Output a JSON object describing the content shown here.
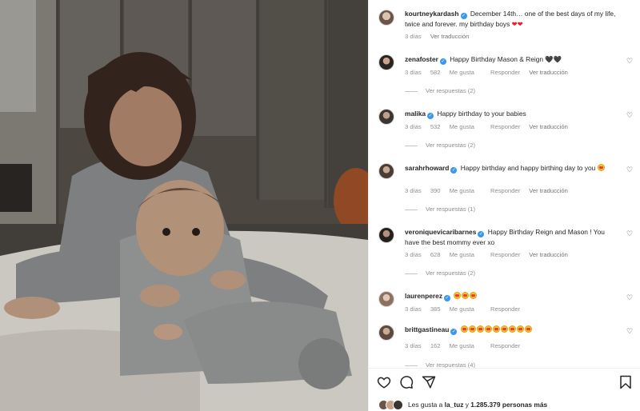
{
  "post": {
    "author": "kourtneykardash",
    "caption": "December 14th… one of the best days of my life, twice and forever. my birthday boys",
    "caption_emoji": "❤❤",
    "age": "3 días",
    "translate": "Ver traducción"
  },
  "labels": {
    "likes_suffix": "Me gusta",
    "reply": "Responder",
    "translate": "Ver traducción"
  },
  "comments": [
    {
      "user": "zenafoster",
      "text": "Happy Birthday Mason & Reign",
      "emoji": "🖤🖤",
      "age": "3 días",
      "likes": "582",
      "replies": "Ver respuestas (2)"
    },
    {
      "user": "malika",
      "text": "Happy birthday to your babies",
      "age": "3 días",
      "likes": "532",
      "replies": "Ver respuestas (2)"
    },
    {
      "user": "sarahrhoward",
      "text": "Happy birthday and happy birthing day to you",
      "age": "3 días",
      "likes": "390",
      "replies": "Ver respuestas (1)"
    },
    {
      "user": "veroniquevicaribarnes",
      "text": "Happy Birthday Reign and Mason ! You have the best mommy ever xo",
      "age": "3 días",
      "likes": "628",
      "replies": "Ver respuestas (2)"
    },
    {
      "user": "laurenperez",
      "text": "",
      "age": "3 días",
      "likes": "385"
    },
    {
      "user": "brittgastineau",
      "text": "",
      "age": "3 días",
      "likes": "162",
      "replies": "Ver respuestas (4)"
    }
  ],
  "likes_summary": {
    "prefix": "Les gusta a",
    "user": "la_tuz",
    "middle": "y",
    "count": "1.285.379",
    "suffix": "personas más"
  },
  "icons": {
    "like": "heart-icon",
    "comment": "comment-icon",
    "share": "share-icon",
    "save": "bookmark-icon",
    "verified": "verified-badge-icon"
  },
  "colors": {
    "verified": "#3897f0",
    "heart": "#ed1c2a",
    "muted_text": "#8e8e8e"
  }
}
